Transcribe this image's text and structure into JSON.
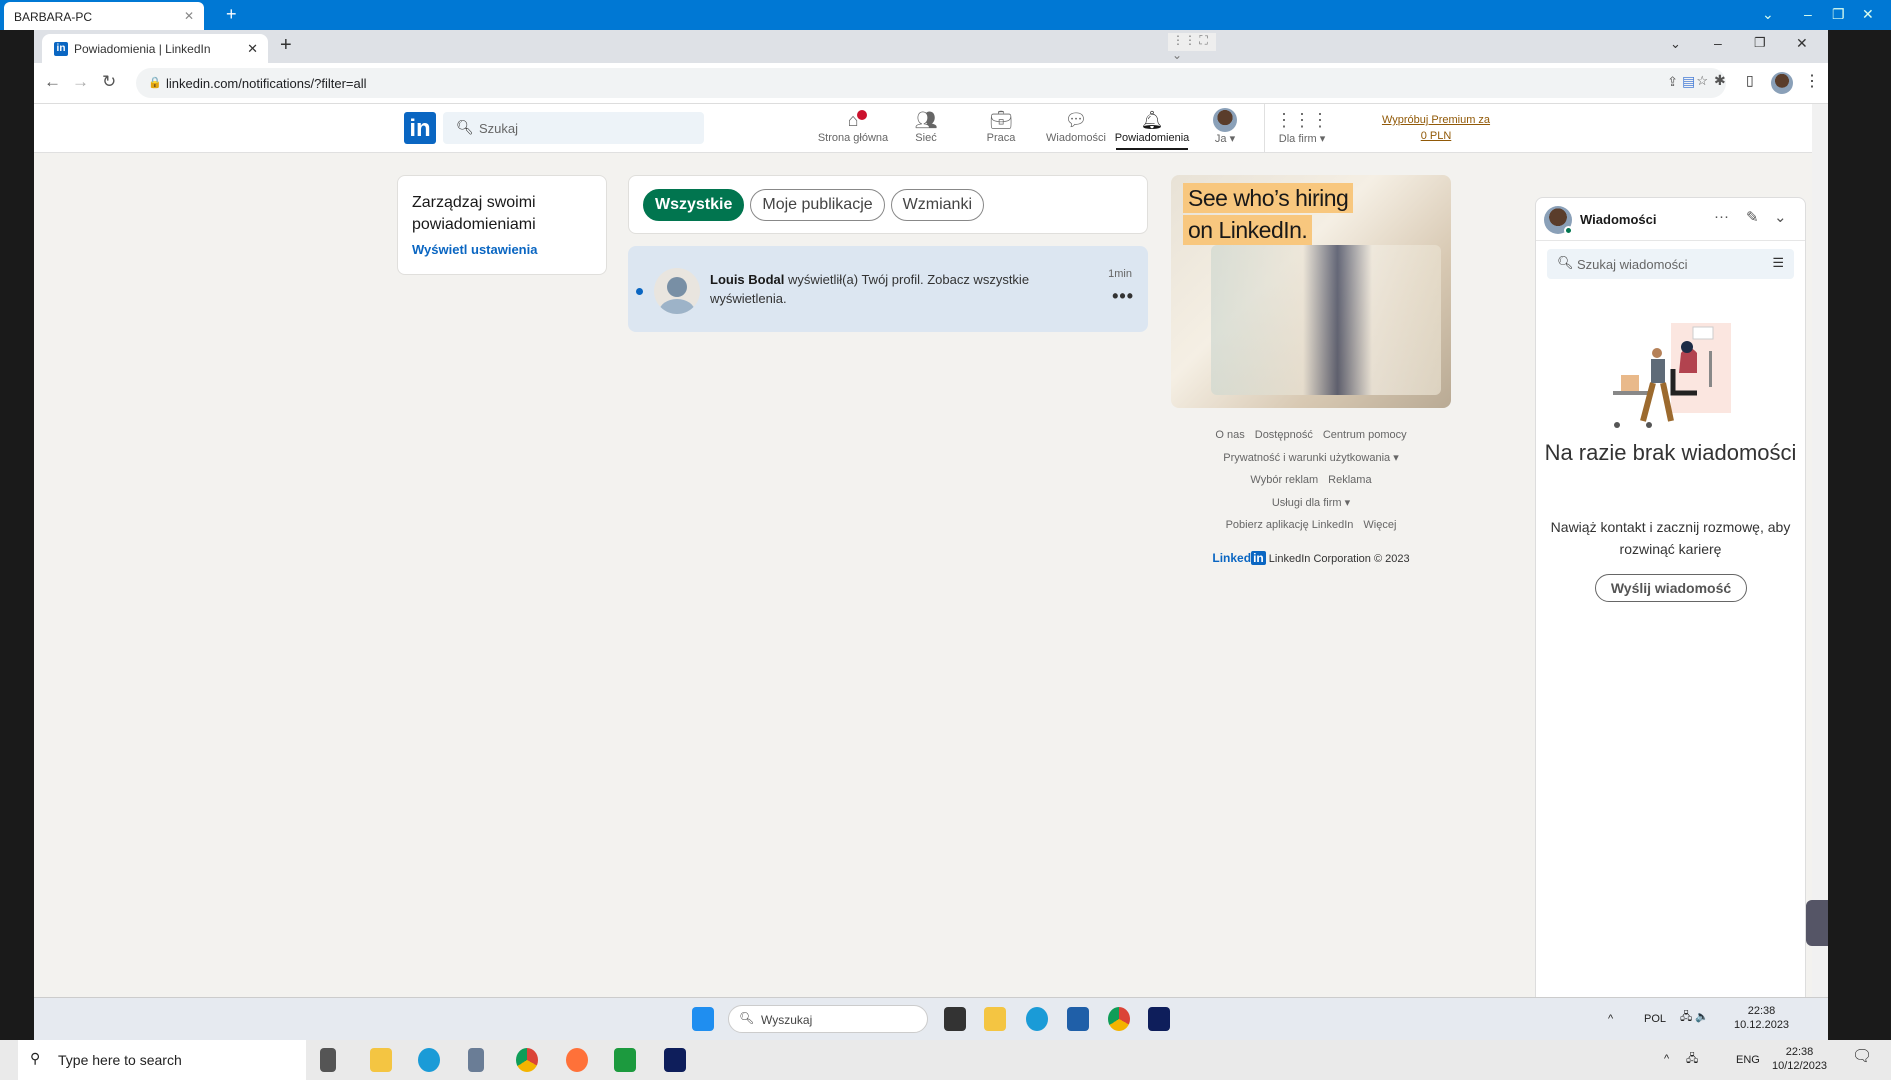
{
  "remote_window": {
    "title": "BARBARA-PC"
  },
  "browser": {
    "tab_title": "Powiadomienia | LinkedIn",
    "url": "linkedin.com/notifications/?filter=all"
  },
  "linkedin_nav": {
    "search_placeholder": "Szukaj",
    "items": [
      {
        "label": "Strona główna",
        "icon": "home-icon"
      },
      {
        "label": "Sieć",
        "icon": "network-icon"
      },
      {
        "label": "Praca",
        "icon": "briefcase-icon"
      },
      {
        "label": "Wiadomości",
        "icon": "chat-icon"
      },
      {
        "label": "Powiadomienia",
        "icon": "bell-icon",
        "active": true
      },
      {
        "label": "Ja ▾",
        "icon": "avatar"
      },
      {
        "label": "Dla firm ▾",
        "icon": "grid-icon"
      }
    ],
    "premium": "Wypróbuj Premium za 0 PLN"
  },
  "left_card": {
    "title": "Zarządzaj swoimi powiadomieniami",
    "link": "Wyświetl ustawienia"
  },
  "filters": [
    {
      "label": "Wszystkie",
      "active": true
    },
    {
      "label": "Moje publikacje"
    },
    {
      "label": "Wzmianki"
    }
  ],
  "notification": {
    "name": "Louis Bodal",
    "text": "wyświetlił(a) Twój profil. Zobacz wszystkie wyświetlenia.",
    "time": "1min"
  },
  "ad": {
    "line1": "See who’s hiring",
    "line2": "on LinkedIn."
  },
  "footer": {
    "rows": [
      [
        "O nas",
        "Dostępność",
        "Centrum pomocy"
      ],
      [
        "Prywatność i warunki użytkowania ▾"
      ],
      [
        "Wybór reklam",
        "Reklama"
      ],
      [
        "Usługi dla firm ▾"
      ],
      [
        "Pobierz aplikację LinkedIn",
        "Więcej"
      ]
    ],
    "brand": "Linked",
    "copyright": "LinkedIn Corporation © 2023"
  },
  "messaging": {
    "title": "Wiadomości",
    "search_placeholder": "Szukaj wiadomości",
    "empty_title": "Na razie brak wiadomości",
    "empty_text": "Nawiąż kontakt i zacznij rozmowę, aby rozwinąć karierę",
    "button": "Wyślij wiadomość"
  },
  "remote_taskbar": {
    "search": "Wyszukaj",
    "lang": "POL",
    "time": "22:38",
    "date": "10.12.2023"
  },
  "local_taskbar": {
    "search": "Type here to search",
    "lang": "ENG",
    "time": "22:38",
    "date": "10/12/2023"
  },
  "colors": {
    "brand": "#0a66c2",
    "filter_active": "#01754f",
    "background": "#f3f2ef",
    "unread": "#dce6f1"
  }
}
